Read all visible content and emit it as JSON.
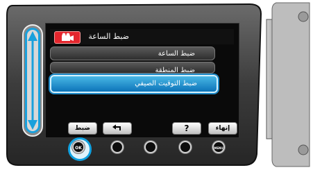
{
  "screen": {
    "title": "ضبط الساعة",
    "menu_items": [
      {
        "label": "ضبط الساعة",
        "state": "normal"
      },
      {
        "label": "ضبط المنطقة",
        "state": "normal"
      },
      {
        "label": "ضبط التوقيت الصيفي",
        "state": "selected"
      }
    ],
    "soft_buttons": {
      "set": "ضبط",
      "back": "",
      "help": "?",
      "end": "إنهاء"
    }
  },
  "hardware_buttons": {
    "ok": "OK",
    "menu": "MENU"
  },
  "colors": {
    "accent": "#1aa0dc",
    "badge": "#e4262d",
    "selection": "#0c73b8"
  }
}
